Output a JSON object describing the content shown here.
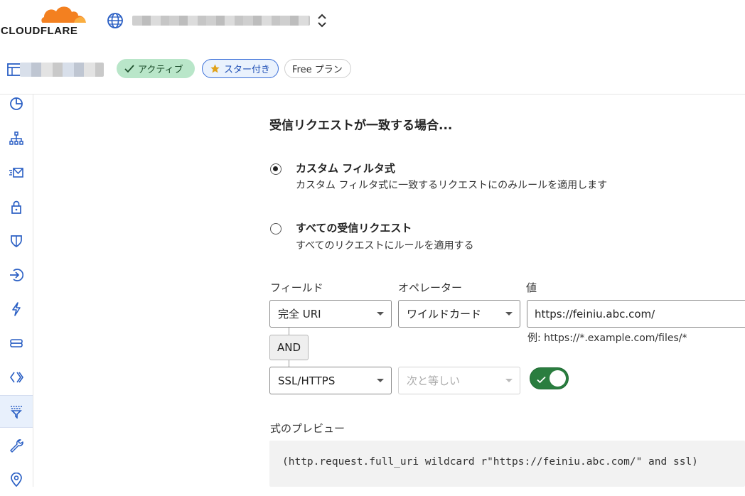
{
  "brand": {
    "name": "CLOUDFLARE",
    "orange": "#f38020",
    "orange_light": "#faae40"
  },
  "account": {
    "icon": "globe-icon",
    "name": ""
  },
  "zone": {
    "icon": "browser-window-icon",
    "name": "",
    "badges": [
      {
        "label": "アクティブ",
        "icon": "check-icon"
      },
      {
        "label": "スター付き",
        "icon": "star-icon"
      },
      {
        "label": "Free プラン",
        "icon": ""
      }
    ]
  },
  "nav": [
    {
      "name": "analytics",
      "icon": "pie-chart-icon"
    },
    {
      "name": "dns",
      "icon": "network-tree-icon"
    },
    {
      "name": "email",
      "icon": "email-icon"
    },
    {
      "name": "ssl-tls",
      "icon": "lock-icon"
    },
    {
      "name": "security",
      "icon": "shield-icon"
    },
    {
      "name": "access",
      "icon": "login-arrow-icon"
    },
    {
      "name": "speed",
      "icon": "lightning-icon"
    },
    {
      "name": "caching",
      "icon": "storage-icon"
    },
    {
      "name": "workers-routes",
      "icon": "code-brackets-icon"
    },
    {
      "name": "rules",
      "icon": "filter-funnel-icon",
      "selected": true
    },
    {
      "name": "network",
      "icon": "wrench-icon"
    },
    {
      "name": "traffic",
      "icon": "location-pin-icon"
    }
  ],
  "form": {
    "heading": "受信リクエストが一致する場合...",
    "options": [
      {
        "title": "カスタム フィルタ式",
        "desc": "カスタム フィルタ式に一致するリクエストにのみルールを適用します",
        "checked": true
      },
      {
        "title": "すべての受信リクエスト",
        "desc": "すべてのリクエストにルールを適用する",
        "checked": false
      }
    ],
    "columns": {
      "field": "フィールド",
      "operator": "オペレーター",
      "value": "値"
    },
    "row1": {
      "field": "完全 URI",
      "operator": "ワイルドカード",
      "value": "https://feiniu.abc.com/",
      "hint": "例: https://*.example.com/files/*"
    },
    "connector": "AND",
    "row2": {
      "field": "SSL/HTTPS",
      "operator": "次と等しい",
      "value_on": true
    },
    "preview_label": "式のプレビュー",
    "preview_expr": "(http.request.full_uri wildcard r\"https://feiniu.abc.com/\" and ssl)"
  }
}
